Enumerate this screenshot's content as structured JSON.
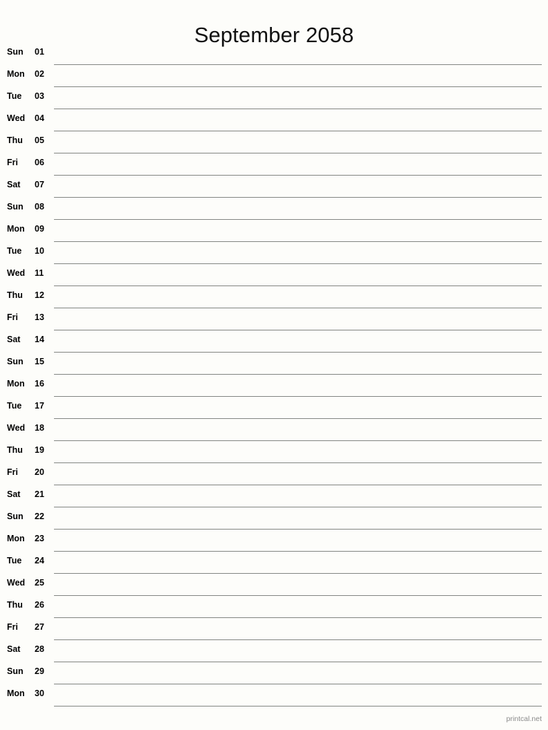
{
  "document": {
    "title": "September 2058",
    "month": "September",
    "year": "2058",
    "footer": "printcal.net",
    "colors": {
      "background": "#fdfdfa",
      "text": "#000000",
      "rule": "#818481",
      "footer_text": "#8a8a8a"
    }
  },
  "days": [
    {
      "weekday": "Sun",
      "date": "01"
    },
    {
      "weekday": "Mon",
      "date": "02"
    },
    {
      "weekday": "Tue",
      "date": "03"
    },
    {
      "weekday": "Wed",
      "date": "04"
    },
    {
      "weekday": "Thu",
      "date": "05"
    },
    {
      "weekday": "Fri",
      "date": "06"
    },
    {
      "weekday": "Sat",
      "date": "07"
    },
    {
      "weekday": "Sun",
      "date": "08"
    },
    {
      "weekday": "Mon",
      "date": "09"
    },
    {
      "weekday": "Tue",
      "date": "10"
    },
    {
      "weekday": "Wed",
      "date": "11"
    },
    {
      "weekday": "Thu",
      "date": "12"
    },
    {
      "weekday": "Fri",
      "date": "13"
    },
    {
      "weekday": "Sat",
      "date": "14"
    },
    {
      "weekday": "Sun",
      "date": "15"
    },
    {
      "weekday": "Mon",
      "date": "16"
    },
    {
      "weekday": "Tue",
      "date": "17"
    },
    {
      "weekday": "Wed",
      "date": "18"
    },
    {
      "weekday": "Thu",
      "date": "19"
    },
    {
      "weekday": "Fri",
      "date": "20"
    },
    {
      "weekday": "Sat",
      "date": "21"
    },
    {
      "weekday": "Sun",
      "date": "22"
    },
    {
      "weekday": "Mon",
      "date": "23"
    },
    {
      "weekday": "Tue",
      "date": "24"
    },
    {
      "weekday": "Wed",
      "date": "25"
    },
    {
      "weekday": "Thu",
      "date": "26"
    },
    {
      "weekday": "Fri",
      "date": "27"
    },
    {
      "weekday": "Sat",
      "date": "28"
    },
    {
      "weekday": "Sun",
      "date": "29"
    },
    {
      "weekday": "Mon",
      "date": "30"
    }
  ]
}
